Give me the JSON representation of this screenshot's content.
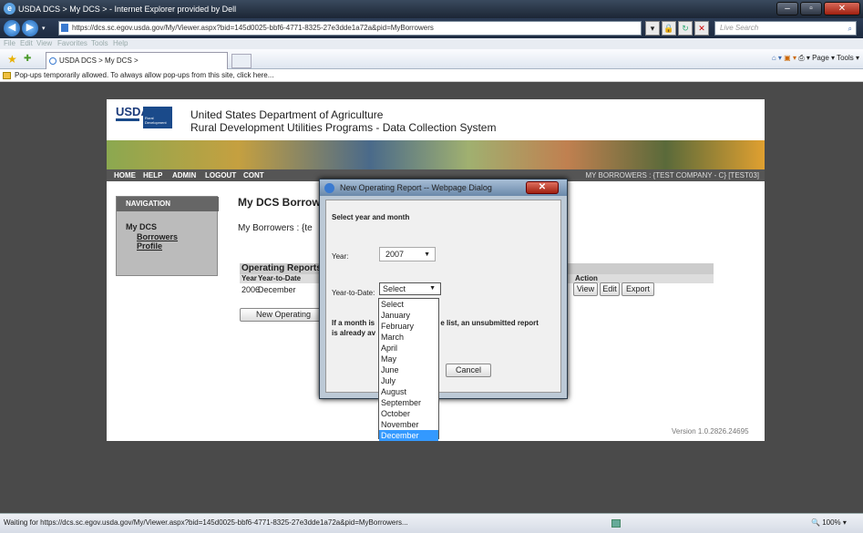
{
  "browser": {
    "title": "USDA DCS > My DCS > - Internet Explorer provided by Dell",
    "url": "https://dcs.sc.egov.usda.gov/My/Viewer.aspx?bid=145d0025-bbf6-4771-8325-27e3dde1a72a&pid=MyBorrowers",
    "search_placeholder": "Live Search",
    "menu": [
      "File",
      "Edit",
      "View",
      "Favorites",
      "Tools",
      "Help"
    ],
    "tab_label": "USDA DCS > My DCS >",
    "tools_label": "Page ▾  Tools ▾",
    "infobar": "Pop-ups temporarily allowed. To always allow pop-ups from this site, click here...",
    "status": "Waiting for https://dcs.sc.egov.usda.gov/My/Viewer.aspx?bid=145d0025-bbf6-4771-8325-27e3dde1a72a&pid=MyBorrowers...",
    "zoom": "100%"
  },
  "site": {
    "logo_text": "USDA",
    "rural_text": "Rural Development",
    "org_line1": "United States Department of Agriculture",
    "org_line2": "Rural Development Utilities Programs - Data Collection System",
    "menu": [
      "HOME",
      "HELP",
      "ADMIN",
      "LOGOUT",
      "CONT"
    ],
    "crumbs": "MY BORROWERS : {TEST COMPANY - C} [TEST03]",
    "nav_header": "NAVIGATION",
    "nav_mydcs": "My DCS",
    "nav_borrowers": "Borrowers",
    "nav_profile": "Profile",
    "heading": "My DCS Borrow",
    "my_borrowers": "My Borrowers : {te",
    "reports_header": "Operating Reports",
    "col_year": "Year",
    "col_ytd": "Year-to-Date",
    "col_action": "Action",
    "row_year": "2006",
    "row_month": "December",
    "btn_view": "View",
    "btn_edit": "Edit",
    "btn_export": "Export",
    "btn_new": "New Operating",
    "version": "Version 1.0.2826.24695"
  },
  "dialog": {
    "title": "New Operating Report -- Webpage Dialog",
    "prompt": "Select year and month",
    "year_label": "Year:",
    "year_value": "2007",
    "ytd_label": "Year-to-Date:",
    "ytd_value": "Select",
    "note_a": "If a month is",
    "note_b": "e list, an unsubmitted report",
    "note_c": "is already av",
    "cancel": "Cancel",
    "options": [
      "Select",
      "January",
      "February",
      "March",
      "April",
      "May",
      "June",
      "July",
      "August",
      "September",
      "October",
      "November",
      "December"
    ],
    "selected_option": "December"
  }
}
